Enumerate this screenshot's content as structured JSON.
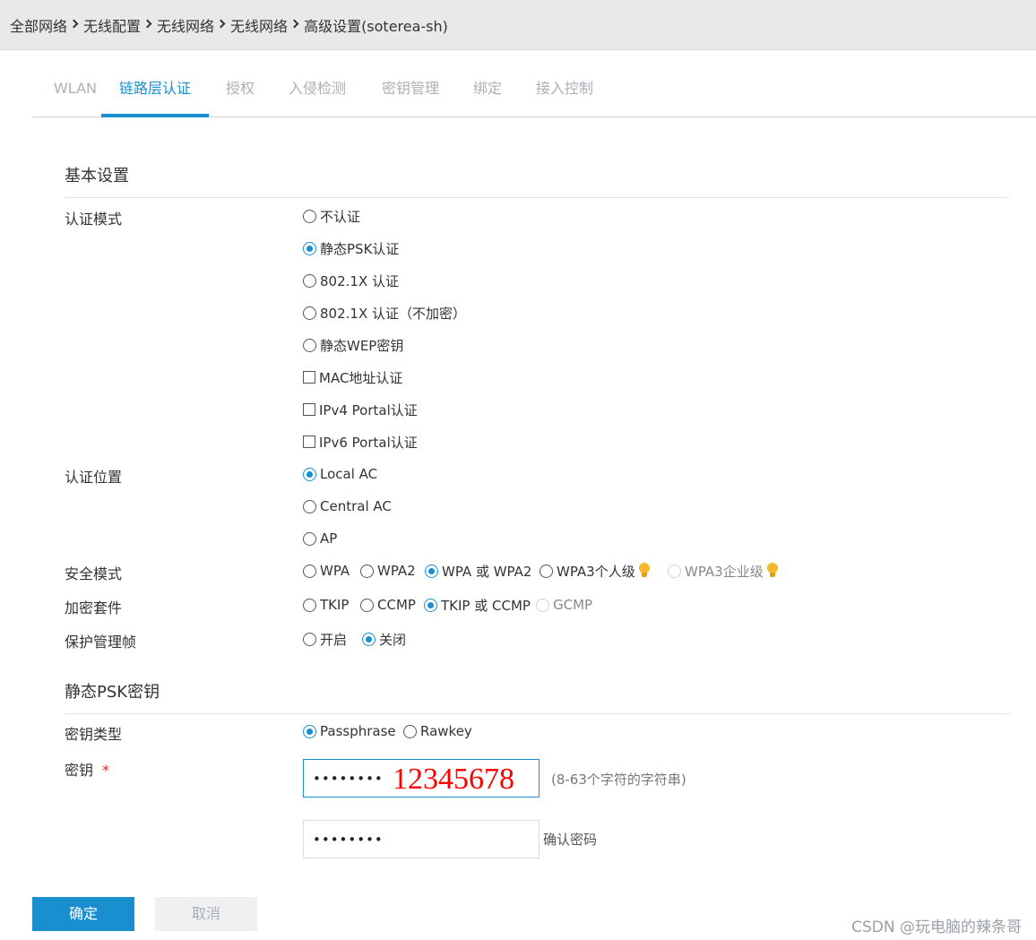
{
  "breadcrumb": [
    "全部网络",
    "无线配置",
    "无线网络",
    "无线网络",
    "高级设置(soterea-sh)"
  ],
  "tabs": [
    "WLAN",
    "链路层认证",
    "授权",
    "入侵检测",
    "密钥管理",
    "绑定",
    "接入控制"
  ],
  "active_tab": "链路层认证",
  "basic": {
    "title": "基本设置",
    "auth_mode": {
      "label": "认证模式",
      "options": [
        "不认证",
        "静态PSK认证",
        "802.1X 认证",
        "802.1X 认证（不加密）",
        "静态WEP密钥"
      ],
      "selected": "静态PSK认证",
      "checkboxes": [
        "MAC地址认证",
        "IPv4 Portal认证",
        "IPv6 Portal认证"
      ]
    },
    "auth_location": {
      "label": "认证位置",
      "options": [
        "Local AC",
        "Central AC",
        "AP"
      ],
      "selected": "Local AC"
    },
    "security_mode": {
      "label": "安全模式",
      "options": [
        "WPA",
        "WPA2",
        "WPA 或 WPA2",
        "WPA3个人级",
        "WPA3企业级"
      ],
      "selected": "WPA 或 WPA2"
    },
    "cipher_suite": {
      "label": "加密套件",
      "options": [
        "TKIP",
        "CCMP",
        "TKIP 或 CCMP",
        "GCMP"
      ],
      "selected": "TKIP 或 CCMP"
    },
    "pmf": {
      "label": "保护管理帧",
      "options": [
        "开启",
        "关闭"
      ],
      "selected": "关闭"
    }
  },
  "psk": {
    "title": "静态PSK密钥",
    "key_type": {
      "label": "密钥类型",
      "options": [
        "Passphrase",
        "Rawkey"
      ],
      "selected": "Passphrase"
    },
    "key": {
      "label": "密钥",
      "required_mark": "*",
      "value": "••••••••",
      "overlay_text": "12345678",
      "hint": "(8-63个字符的字符串)"
    },
    "confirm": {
      "value": "••••••••",
      "hint": "确认密码"
    }
  },
  "buttons": {
    "ok": "确定",
    "cancel": "取消"
  },
  "watermark": "CSDN @玩电脑的辣条哥",
  "colors": {
    "accent": "#1a8fd0",
    "overlay": "#ff0000",
    "breadcrumb_bg": "#e8e9eb"
  }
}
